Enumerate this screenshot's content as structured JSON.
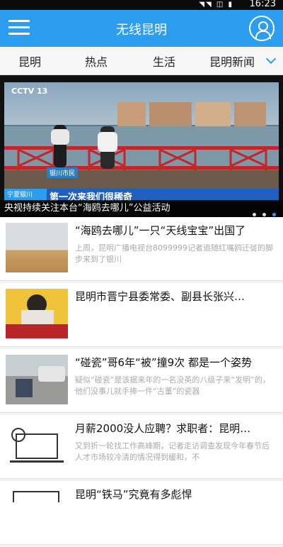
{
  "status": {
    "time": "16:23",
    "signal": "◥◥ ◫ ▮"
  },
  "header": {
    "title": "无线昆明"
  },
  "tabs": [
    "昆明",
    "热点",
    "生活",
    "昆明新闻"
  ],
  "banner": {
    "channel_logo": "CCTV 13",
    "location_tag": "银川市民",
    "lower_third_tag": "宁夏银川",
    "lower_third_caption": "第一次来我们很稀奇",
    "caption": "央视持续关注本台“海鸥去哪儿”公益活动"
  },
  "news": [
    {
      "title": "“海鸥去哪儿”一只“天线宝宝”出国了",
      "desc": "上周，昆明广播电视台8099999记者追随红嘴鸥迁徙的脚步来到了银川"
    },
    {
      "title": "昆明市晋宁县委常委、副县长张兴…",
      "desc": ""
    },
    {
      "title": "“碰瓷”哥6年“被”撞9次 都是一个姿势",
      "desc": "疑似“碰瓷”是该据来年的一名没英的八级子来“发明”的，他们没事儿就手捧一件“古董”的瓷器"
    },
    {
      "title": "月薪2000没人应聘？求职者：昆明…",
      "desc": "又到折一轮找工作高峰期，记者走访调查发现今年春节后人才市场较冷清的情况得到缓和，不"
    },
    {
      "title": "昆明“铁马”究竟有多彪悍",
      "desc": ""
    }
  ],
  "colors": {
    "accent": "#2d9df0"
  }
}
